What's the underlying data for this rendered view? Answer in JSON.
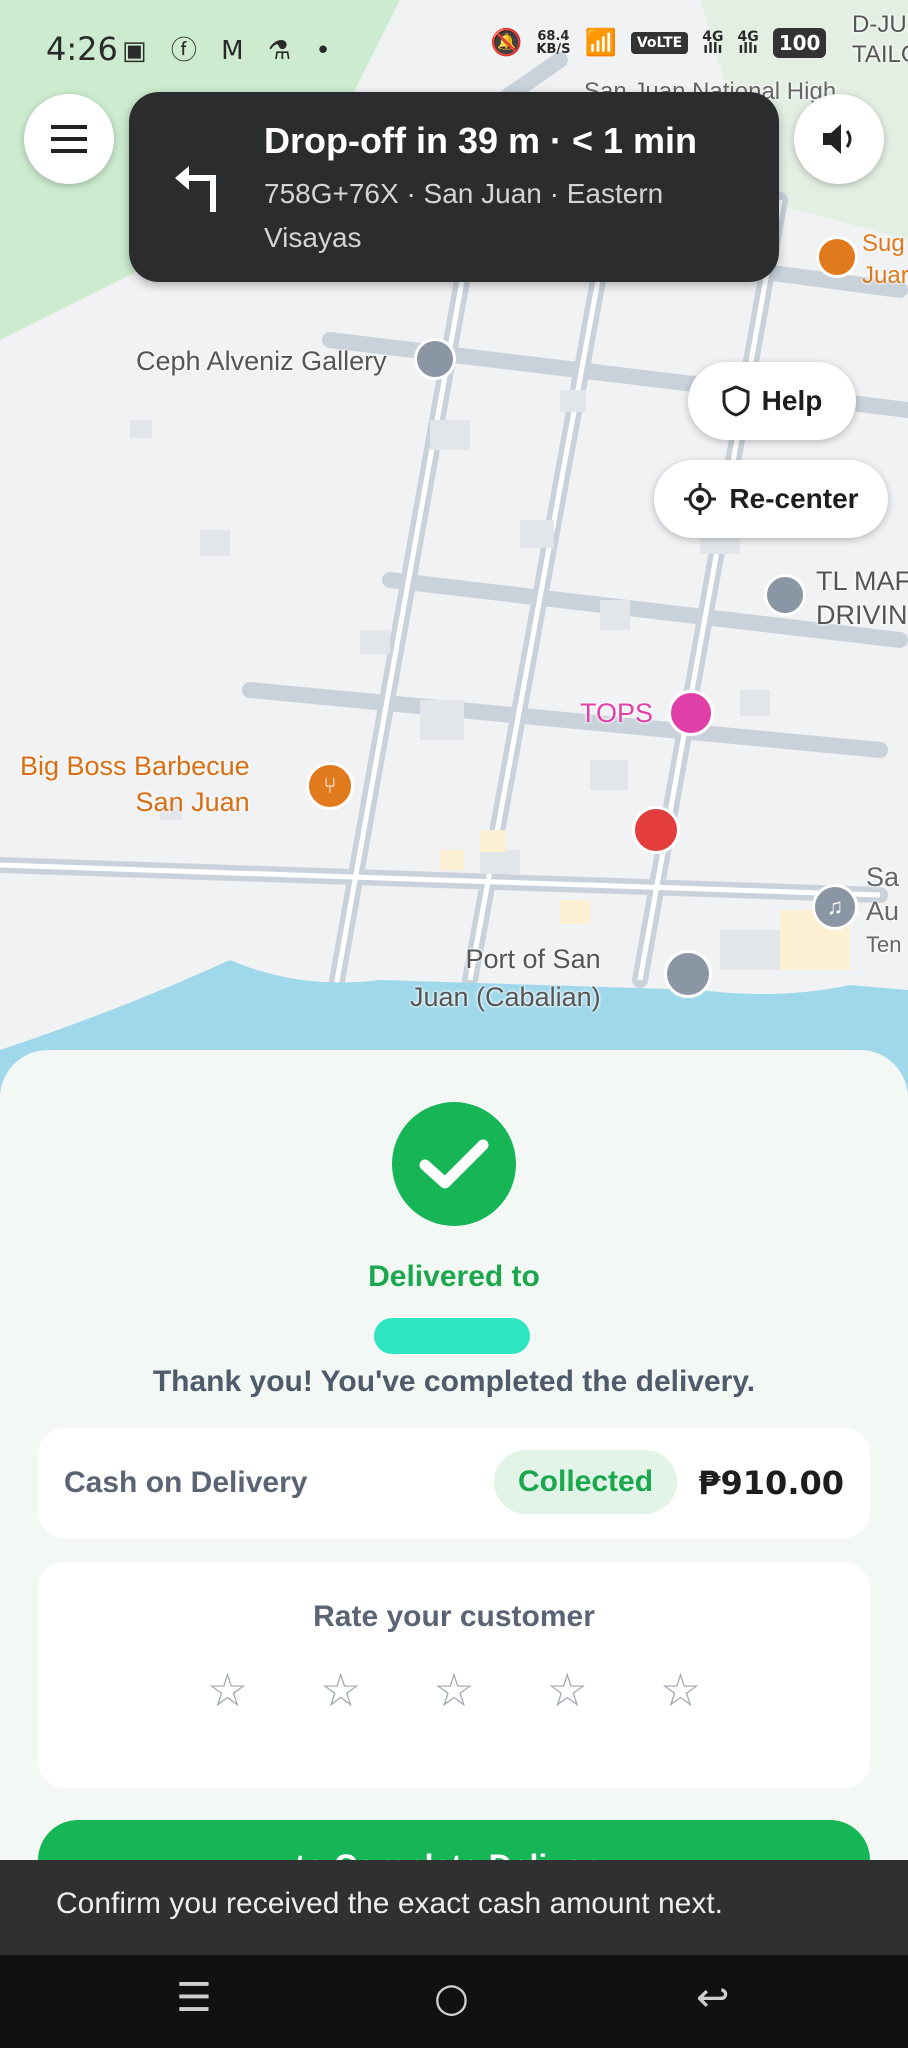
{
  "status_bar": {
    "time": "4:26",
    "net_speed_value": "68.4",
    "net_speed_unit": "KB/S",
    "volte": "VoLTE",
    "sim1": "4G",
    "sim2": "4G",
    "battery": "100"
  },
  "navigation": {
    "title": "Drop-off in 39 m · < 1 min",
    "address": "758G+76X · San Juan · Eastern Visayas",
    "help_label": "Help",
    "recenter_label": "Re-center"
  },
  "map": {
    "labels": {
      "gallery": "Ceph Alveniz Gallery",
      "tops": "TOPS",
      "bbq_line1": "Big Boss Barbecue",
      "bbq_line2": "San Juan",
      "port_line1": "Port of San",
      "port_line2": "Juan (Cabalian)",
      "tl_line1": "TL MAF",
      "tl_line2": "DRIVIN",
      "sug_line1": "Sug",
      "sug_line2": "Juar",
      "dju_line1": "D-JU",
      "dju_line2": "TAILC",
      "high": "San Juan National High",
      "sa_line1": "Sa",
      "sa_line2": "Au",
      "sa_line3": "Ten"
    }
  },
  "delivery": {
    "status_label": "Delivered to",
    "thanks": "Thank you! You've completed the delivery.",
    "payment_method": "Cash on Delivery",
    "payment_status": "Collected",
    "amount": "₱910.00",
    "rate_title": "Rate your customer",
    "rating": 0,
    "complete_button": "to Complete Delivery"
  },
  "toast": {
    "message": "Confirm you received the exact cash amount next."
  },
  "colors": {
    "accent_green": "#16b556",
    "dark_card": "#2b2c2e",
    "water": "#9fd8ea",
    "tops_pink": "#e040a8",
    "food_orange": "#e07a1c"
  }
}
